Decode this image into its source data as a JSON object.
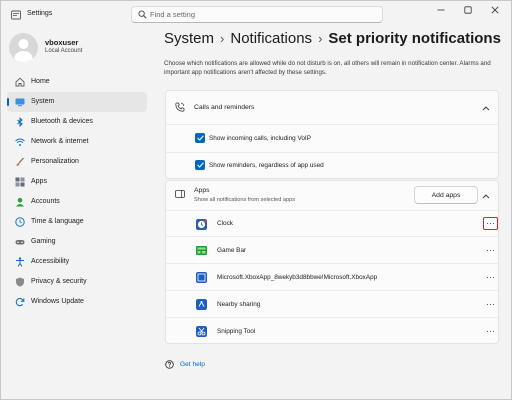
{
  "window": {
    "title": "Settings"
  },
  "search": {
    "placeholder": "Find a setting"
  },
  "profile": {
    "name": "vboxuser",
    "account_type": "Local Account"
  },
  "sidebar": {
    "items": [
      {
        "label": "Home",
        "icon": "home-icon",
        "color": "#5c5c5c"
      },
      {
        "label": "System",
        "icon": "system-icon",
        "color": "#0067c0",
        "active": true
      },
      {
        "label": "Bluetooth & devices",
        "icon": "bluetooth-icon",
        "color": "#0067c0"
      },
      {
        "label": "Network & internet",
        "icon": "wifi-icon",
        "color": "#1a73c9"
      },
      {
        "label": "Personalization",
        "icon": "brush-icon",
        "color": "#d97a3a"
      },
      {
        "label": "Apps",
        "icon": "apps-icon",
        "color": "#5f6b7a"
      },
      {
        "label": "Accounts",
        "icon": "accounts-icon",
        "color": "#2f9e44"
      },
      {
        "label": "Time & language",
        "icon": "globe-clock-icon",
        "color": "#1a73c9"
      },
      {
        "label": "Gaming",
        "icon": "gamepad-icon",
        "color": "#707070"
      },
      {
        "label": "Accessibility",
        "icon": "accessibility-icon",
        "color": "#1f5fbf"
      },
      {
        "label": "Privacy & security",
        "icon": "shield-icon",
        "color": "#707070"
      },
      {
        "label": "Windows Update",
        "icon": "update-icon",
        "color": "#1a73c9"
      }
    ]
  },
  "breadcrumb": {
    "part1": "System",
    "part2": "Notifications",
    "current": "Set priority notifications"
  },
  "description": "Choose which notifications are allowed while do not disturb is on, all others will remain in notification center. Alarms and important app notifications aren't affected by these settings.",
  "calls_card": {
    "title": "Calls and reminders",
    "options": [
      {
        "label": "Show incoming calls, including VoIP",
        "checked": true
      },
      {
        "label": "Show reminders, regardless of app used",
        "checked": true
      }
    ]
  },
  "apps_card": {
    "title": "Apps",
    "subtitle": "Show all notifications from selected apps",
    "add_button": "Add apps",
    "apps": [
      {
        "label": "Clock",
        "icon": "clock-app-icon"
      },
      {
        "label": "Game Bar",
        "icon": "game-bar-app-icon"
      },
      {
        "label": "Microsoft.XboxApp_8wekyb3d8bbwe!Microsoft.XboxApp",
        "icon": "xbox-app-icon"
      },
      {
        "label": "Nearby sharing",
        "icon": "nearby-sharing-app-icon"
      },
      {
        "label": "Snipping Tool",
        "icon": "snipping-tool-app-icon"
      }
    ]
  },
  "help": {
    "label": "Get help"
  },
  "colors": {
    "accent": "#0067c0",
    "highlight_border": "#d9262c",
    "background": "#f3f3f3",
    "card": "#fbfbfb"
  }
}
